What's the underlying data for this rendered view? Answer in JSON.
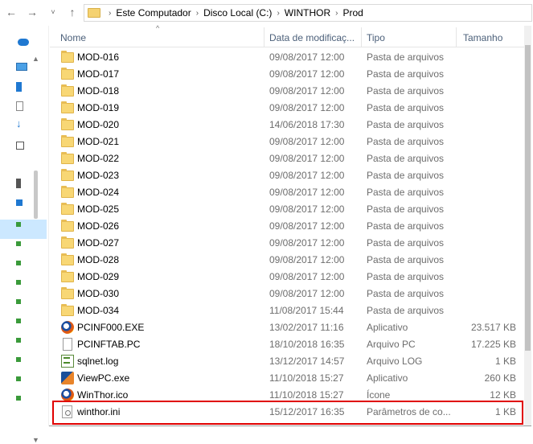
{
  "address_bar": {
    "crumbs": [
      "Este Computador",
      "Disco Local (C:)",
      "WINTHOR",
      "Prod"
    ]
  },
  "columns": {
    "name": "Nome",
    "date": "Data de modificaç...",
    "type": "Tipo",
    "size": "Tamanho"
  },
  "files": [
    {
      "name": "MOD-016",
      "date": "09/08/2017 12:00",
      "type": "Pasta de arquivos",
      "size": "",
      "icon": "folder-icon"
    },
    {
      "name": "MOD-017",
      "date": "09/08/2017 12:00",
      "type": "Pasta de arquivos",
      "size": "",
      "icon": "folder-icon"
    },
    {
      "name": "MOD-018",
      "date": "09/08/2017 12:00",
      "type": "Pasta de arquivos",
      "size": "",
      "icon": "folder-icon"
    },
    {
      "name": "MOD-019",
      "date": "09/08/2017 12:00",
      "type": "Pasta de arquivos",
      "size": "",
      "icon": "folder-icon"
    },
    {
      "name": "MOD-020",
      "date": "14/06/2018 17:30",
      "type": "Pasta de arquivos",
      "size": "",
      "icon": "folder-icon"
    },
    {
      "name": "MOD-021",
      "date": "09/08/2017 12:00",
      "type": "Pasta de arquivos",
      "size": "",
      "icon": "folder-icon"
    },
    {
      "name": "MOD-022",
      "date": "09/08/2017 12:00",
      "type": "Pasta de arquivos",
      "size": "",
      "icon": "folder-icon"
    },
    {
      "name": "MOD-023",
      "date": "09/08/2017 12:00",
      "type": "Pasta de arquivos",
      "size": "",
      "icon": "folder-icon"
    },
    {
      "name": "MOD-024",
      "date": "09/08/2017 12:00",
      "type": "Pasta de arquivos",
      "size": "",
      "icon": "folder-icon"
    },
    {
      "name": "MOD-025",
      "date": "09/08/2017 12:00",
      "type": "Pasta de arquivos",
      "size": "",
      "icon": "folder-icon"
    },
    {
      "name": "MOD-026",
      "date": "09/08/2017 12:00",
      "type": "Pasta de arquivos",
      "size": "",
      "icon": "folder-icon"
    },
    {
      "name": "MOD-027",
      "date": "09/08/2017 12:00",
      "type": "Pasta de arquivos",
      "size": "",
      "icon": "folder-icon"
    },
    {
      "name": "MOD-028",
      "date": "09/08/2017 12:00",
      "type": "Pasta de arquivos",
      "size": "",
      "icon": "folder-icon"
    },
    {
      "name": "MOD-029",
      "date": "09/08/2017 12:00",
      "type": "Pasta de arquivos",
      "size": "",
      "icon": "folder-icon"
    },
    {
      "name": "MOD-030",
      "date": "09/08/2017 12:00",
      "type": "Pasta de arquivos",
      "size": "",
      "icon": "folder-icon"
    },
    {
      "name": "MOD-034",
      "date": "11/08/2017 15:44",
      "type": "Pasta de arquivos",
      "size": "",
      "icon": "folder-icon"
    },
    {
      "name": "PCINF000.EXE",
      "date": "13/02/2017 11:16",
      "type": "Aplicativo",
      "size": "23.517 KB",
      "icon": "winthor-app-icon"
    },
    {
      "name": "PCINFTAB.PC",
      "date": "18/10/2018 16:35",
      "type": "Arquivo PC",
      "size": "17.225 KB",
      "icon": "document-icon"
    },
    {
      "name": "sqlnet.log",
      "date": "13/12/2017 14:57",
      "type": "Arquivo LOG",
      "size": "1 KB",
      "icon": "log-file-icon"
    },
    {
      "name": "ViewPC.exe",
      "date": "11/10/2018 15:27",
      "type": "Aplicativo",
      "size": "260 KB",
      "icon": "viewpc-app-icon"
    },
    {
      "name": "WinThor.ico",
      "date": "11/10/2018 15:27",
      "type": "Ícone",
      "size": "12 KB",
      "icon": "winthor-app-icon"
    },
    {
      "name": "winthor.ini",
      "date": "15/12/2017 16:35",
      "type": "Parâmetros de co...",
      "size": "1 KB",
      "icon": "ini-settings-icon"
    }
  ],
  "colors": {
    "highlight": "#e00000",
    "folder": "#f8d775",
    "header_text": "#4c607a",
    "nav_selected": "#cce8ff"
  }
}
